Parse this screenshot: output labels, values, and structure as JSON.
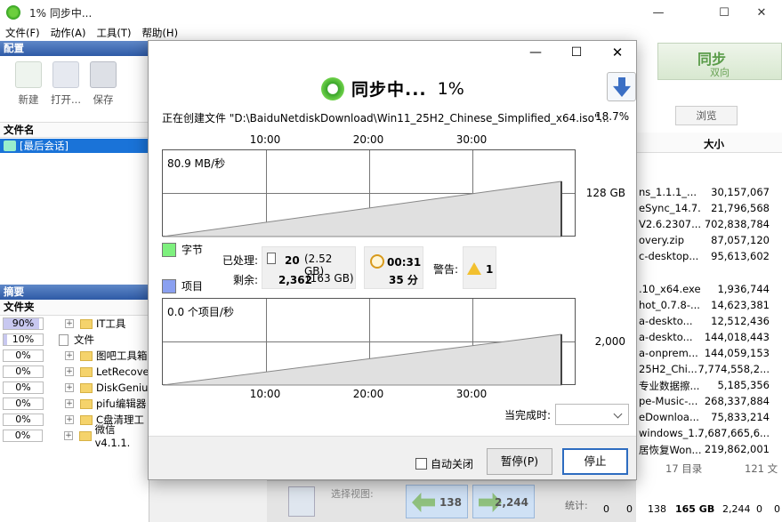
{
  "main": {
    "title": "1% 同步中...",
    "menu": [
      "文件(F)",
      "动作(A)",
      "工具(T)",
      "帮助(H)"
    ],
    "config_header": "配置",
    "toolbar": {
      "new": "新建",
      "open": "打开...",
      "save": "保存"
    },
    "file_col": "文件名",
    "session_item": "[最后会话]",
    "summary_header": "摘要",
    "folder_col": "文件夹",
    "folders": [
      {
        "pct": "90%",
        "fill": 0.9,
        "name": "IT工具",
        "type": "folder"
      },
      {
        "pct": "10%",
        "fill": 0.1,
        "name": "文件",
        "type": "file"
      },
      {
        "pct": "0%",
        "fill": 0,
        "name": "图吧工具箱",
        "type": "folder"
      },
      {
        "pct": "0%",
        "fill": 0,
        "name": "LetRecove",
        "type": "folder"
      },
      {
        "pct": "0%",
        "fill": 0,
        "name": "DiskGeniu",
        "type": "folder"
      },
      {
        "pct": "0%",
        "fill": 0,
        "name": "pifu编辑器",
        "type": "folder"
      },
      {
        "pct": "0%",
        "fill": 0,
        "name": "C盘清理工",
        "type": "folder"
      },
      {
        "pct": "0%",
        "fill": 0,
        "name": "微信v4.1.1.",
        "type": "folder"
      }
    ]
  },
  "right": {
    "sync_title": "同步",
    "sync_sub": "双向",
    "browse": "浏览",
    "size_col": "大小",
    "rows": [
      {
        "name": "ns_1.1.1_...",
        "size": "30,157,067"
      },
      {
        "name": "eSync_14.7...",
        "size": "21,796,568"
      },
      {
        "name": "V2.6.2307...",
        "size": "702,838,784"
      },
      {
        "name": "overy.zip",
        "size": "87,057,120"
      },
      {
        "name": "c-desktop...",
        "size": "95,613,602"
      },
      {
        "name": "",
        "size": ""
      },
      {
        "name": ".10_x64.exe",
        "size": "1,936,744"
      },
      {
        "name": "hot_0.7.8-...",
        "size": "14,623,381"
      },
      {
        "name": "a-deskto...",
        "size": "12,512,436"
      },
      {
        "name": "a-deskto...",
        "size": "144,018,443"
      },
      {
        "name": "a-onprem...",
        "size": "144,059,153"
      },
      {
        "name": "25H2_Chi...",
        "size": "7,774,558,2..."
      },
      {
        "name": "专业数据擦...",
        "size": "5,185,356"
      },
      {
        "name": "pe-Music-...",
        "size": "268,337,884"
      },
      {
        "name": "eDownloa...",
        "size": "75,833,214"
      },
      {
        "name": "windows_1...",
        "size": "7,687,665,6..."
      },
      {
        "name": "居恢复Won...",
        "size": "219,862,001"
      }
    ],
    "dir_count": "17 目录",
    "file_count": "121 文"
  },
  "bottom": {
    "view_label": "选择视图:",
    "left_count": "138",
    "right_count": "2,244",
    "stats_label": "统计:",
    "stats": {
      "a": "0",
      "b": "0",
      "c": "138",
      "d": "165 GB",
      "e": "2,244",
      "f": "0",
      "g": "0"
    }
  },
  "dialog": {
    "title": "同步中...",
    "percent": "1%",
    "current_file": "正在创建文件 \"D:\\BaiduNetdiskDownload\\Win11_25H2_Chinese_Simplified_x64.iso\"...",
    "current_pct": "18.7%",
    "ticks": [
      "10:00",
      "20:00",
      "30:00"
    ],
    "bytes_rate": "80.9 MB/秒",
    "bytes_scale": "128 GB",
    "items_rate": "0.0 个项目/秒",
    "items_scale": "2,000",
    "legend_bytes": "字节",
    "legend_items": "项目",
    "processed_label": "已处理:",
    "remaining_label": "剩余:",
    "processed_count": "20",
    "processed_size": "(2.52 GB)",
    "remaining_count": "2,362",
    "remaining_size": "(163 GB)",
    "time_elapsed": "00:31",
    "time_remaining": "35 分",
    "warnings_label": "警告:",
    "warnings": "1",
    "when_done_label": "当完成时:",
    "auto_close": "自动关闭",
    "pause": "暂停(P)",
    "stop": "停止",
    "colors": {
      "bytes": "#7ef07e",
      "items": "#8aa0f0"
    }
  }
}
